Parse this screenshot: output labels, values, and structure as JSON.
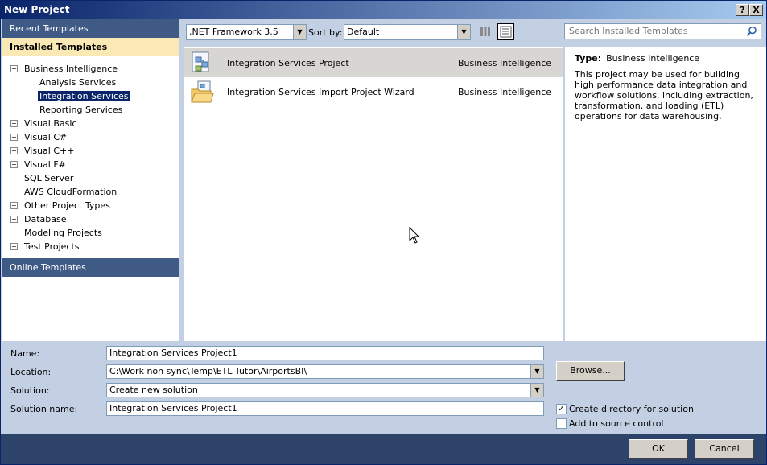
{
  "window": {
    "title": "New Project",
    "help_btn": "?",
    "close_btn": "X"
  },
  "left": {
    "recent": "Recent Templates",
    "installed": "Installed Templates",
    "online": "Online Templates",
    "tree": [
      {
        "label": "Business Intelligence",
        "expander": "−"
      },
      {
        "label": "Analysis Services"
      },
      {
        "label": "Integration Services"
      },
      {
        "label": "Reporting Services"
      },
      {
        "label": "Visual Basic",
        "expander": "+"
      },
      {
        "label": "Visual C#",
        "expander": "+"
      },
      {
        "label": "Visual C++",
        "expander": "+"
      },
      {
        "label": "Visual F#",
        "expander": "+"
      },
      {
        "label": "SQL Server"
      },
      {
        "label": "AWS CloudFormation"
      },
      {
        "label": "Other Project Types",
        "expander": "+"
      },
      {
        "label": "Database",
        "expander": "+"
      },
      {
        "label": "Modeling Projects"
      },
      {
        "label": "Test Projects",
        "expander": "+"
      }
    ]
  },
  "toolbar": {
    "framework": ".NET Framework 3.5",
    "sort_label": "Sort by:",
    "sort_value": "Default",
    "search_placeholder": "Search Installed Templates"
  },
  "templates": [
    {
      "name": "Integration Services Project",
      "category": "Business Intelligence"
    },
    {
      "name": "Integration Services Import Project Wizard",
      "category": "Business Intelligence"
    }
  ],
  "details": {
    "type_label": "Type:",
    "type_value": "Business Intelligence",
    "description": "This project may be used for building high performance data integration and workflow solutions, including extraction, transformation, and loading (ETL) operations for data warehousing."
  },
  "form": {
    "name_label": "Name:",
    "name_value": "Integration Services Project1",
    "location_label": "Location:",
    "location_value": "C:\\Work non sync\\Temp\\ETL Tutor\\AirportsBI\\",
    "solution_label": "Solution:",
    "solution_value": "Create new solution",
    "solution_name_label": "Solution name:",
    "solution_name_value": "Integration Services Project1",
    "browse": "Browse...",
    "create_dir": "Create directory for solution",
    "create_dir_checked": "✓",
    "add_source": "Add to source control"
  },
  "buttons": {
    "ok": "OK",
    "cancel": "Cancel"
  },
  "colors": {
    "header": "#3f5a85",
    "installed": "#fbe9b5",
    "background": "#c3d0e3",
    "selection": "#0a246a"
  }
}
